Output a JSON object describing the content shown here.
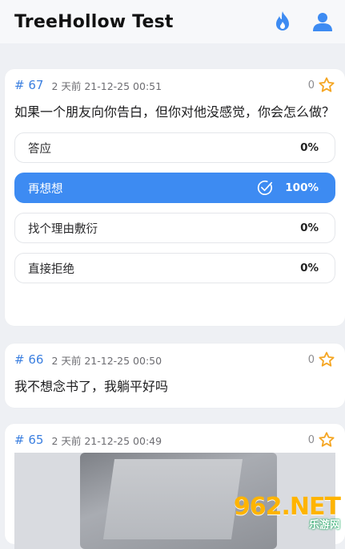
{
  "header": {
    "title": "TreeHollow Test"
  },
  "posts": [
    {
      "id": "# 67",
      "time": "2 天前 21-12-25 00:51",
      "likes": "0",
      "text": "如果一个朋友向你告白，但你对他没感觉，你会怎么做？",
      "vote_options": [
        {
          "label": "答应",
          "percent": "0%"
        },
        {
          "label": "再想想",
          "percent": "100%"
        },
        {
          "label": "找个理由敷衍",
          "percent": "0%"
        },
        {
          "label": "直接拒绝",
          "percent": "0%"
        }
      ]
    },
    {
      "id": "# 66",
      "time": "2 天前 21-12-25 00:50",
      "likes": "0",
      "text": "我不想念书了，我躺平好吗"
    },
    {
      "id": "# 65",
      "time": "2 天前 21-12-25 00:49",
      "likes": "0"
    }
  ],
  "watermark": {
    "main": "962.NET",
    "sub": "乐游网"
  },
  "colors": {
    "accent": "#3d8bf2",
    "star": "#f5a623",
    "id": "#3b7fe0"
  }
}
